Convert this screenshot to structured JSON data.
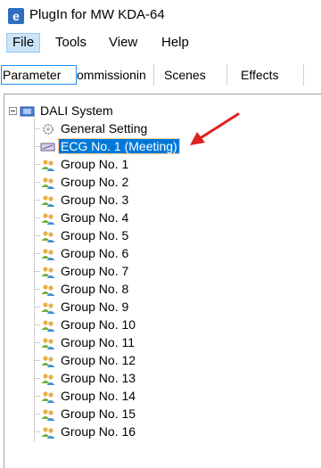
{
  "window": {
    "title": "PlugIn for MW KDA-64",
    "app_icon_letter": "e"
  },
  "menu": [
    {
      "label": "File",
      "active": true
    },
    {
      "label": "Tools",
      "active": false
    },
    {
      "label": "View",
      "active": false
    },
    {
      "label": "Help",
      "active": false
    }
  ],
  "tabs": [
    {
      "label": "Parameter",
      "selected": true
    },
    {
      "label": "ommissionin",
      "selected": false
    },
    {
      "label": "Scenes",
      "selected": false
    },
    {
      "label": "Effects",
      "selected": false
    }
  ],
  "tree": {
    "root": {
      "label": "DALI System",
      "expanded": true,
      "icon": "dali-system-icon"
    },
    "children": [
      {
        "label": "General Setting",
        "icon": "gear-icon",
        "selected": false
      },
      {
        "label": "ECG No. 1 (Meeting)",
        "icon": "ecg-device-icon",
        "selected": true
      },
      {
        "label": "Group No. 1",
        "icon": "group-icon",
        "selected": false
      },
      {
        "label": "Group No. 2",
        "icon": "group-icon",
        "selected": false
      },
      {
        "label": "Group No. 3",
        "icon": "group-icon",
        "selected": false
      },
      {
        "label": "Group No. 4",
        "icon": "group-icon",
        "selected": false
      },
      {
        "label": "Group No. 5",
        "icon": "group-icon",
        "selected": false
      },
      {
        "label": "Group No. 6",
        "icon": "group-icon",
        "selected": false
      },
      {
        "label": "Group No. 7",
        "icon": "group-icon",
        "selected": false
      },
      {
        "label": "Group No. 8",
        "icon": "group-icon",
        "selected": false
      },
      {
        "label": "Group No. 9",
        "icon": "group-icon",
        "selected": false
      },
      {
        "label": "Group No. 10",
        "icon": "group-icon",
        "selected": false
      },
      {
        "label": "Group No. 11",
        "icon": "group-icon",
        "selected": false
      },
      {
        "label": "Group No. 12",
        "icon": "group-icon",
        "selected": false
      },
      {
        "label": "Group No. 13",
        "icon": "group-icon",
        "selected": false
      },
      {
        "label": "Group No. 14",
        "icon": "group-icon",
        "selected": false
      },
      {
        "label": "Group No. 15",
        "icon": "group-icon",
        "selected": false
      },
      {
        "label": "Group No. 16",
        "icon": "group-icon",
        "selected": false
      }
    ]
  },
  "colors": {
    "selection": "#0078d7",
    "annotation_arrow": "#e02020",
    "menu_active": "#cce4f7",
    "tab_selected_border": "#1e90ff"
  }
}
